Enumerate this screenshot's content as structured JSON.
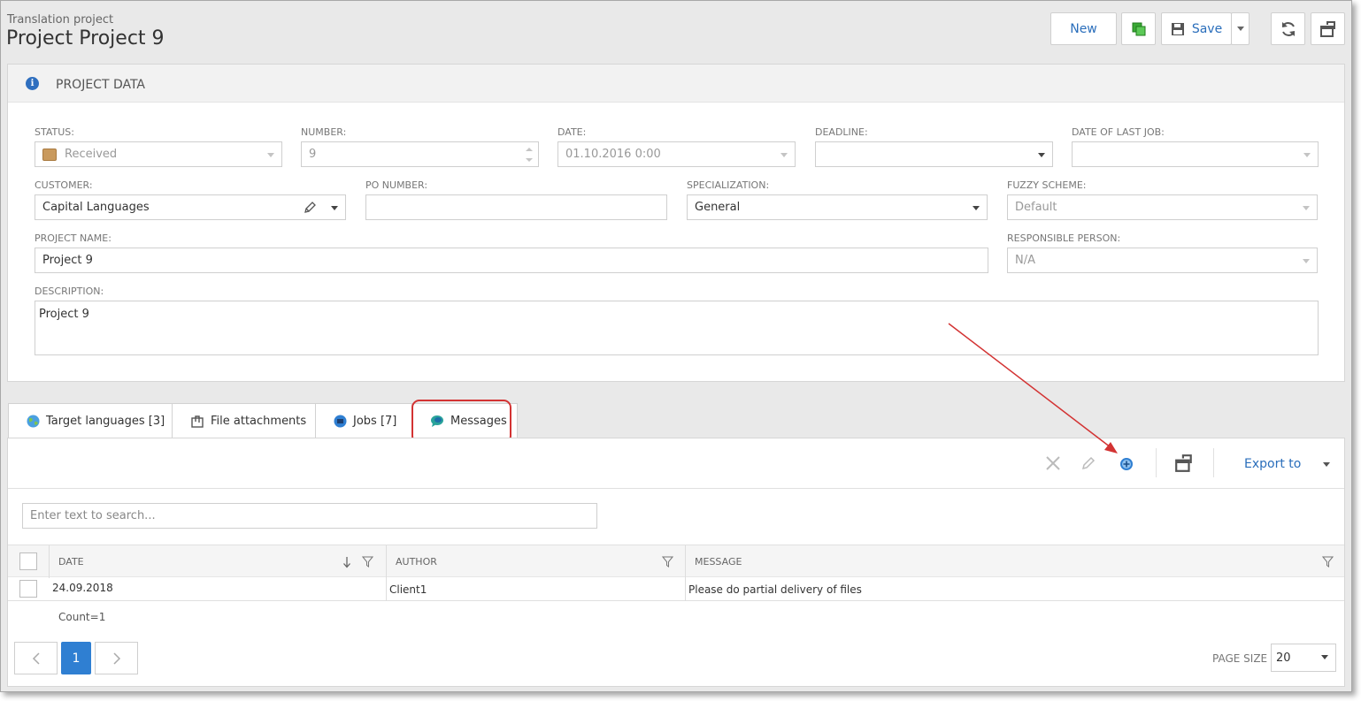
{
  "header": {
    "subtitle": "Translation project",
    "title": "Project Project 9",
    "new_label": "New",
    "save_label": "Save"
  },
  "project_data": {
    "section_title": "PROJECT DATA",
    "status": {
      "label": "STATUS:",
      "value": "Received"
    },
    "number": {
      "label": "NUMBER:",
      "value": "9"
    },
    "date": {
      "label": "DATE:",
      "value": "01.10.2016 0:00"
    },
    "deadline": {
      "label": "DEADLINE:",
      "value": ""
    },
    "date_last_job": {
      "label": "DATE OF LAST JOB:",
      "value": ""
    },
    "customer": {
      "label": "CUSTOMER:",
      "value": "Capital Languages"
    },
    "po_number": {
      "label": "PO NUMBER:",
      "value": ""
    },
    "specialization": {
      "label": "SPECIALIZATION:",
      "value": "General"
    },
    "fuzzy_scheme": {
      "label": "FUZZY SCHEME:",
      "value": "Default"
    },
    "project_name": {
      "label": "PROJECT NAME:",
      "value": "Project 9"
    },
    "responsible_person": {
      "label": "RESPONSIBLE PERSON:",
      "value": "N/A"
    },
    "description": {
      "label": "DESCRIPTION:",
      "value": "Project 9"
    }
  },
  "tabs": [
    {
      "label": "Target languages [3]"
    },
    {
      "label": "File attachments"
    },
    {
      "label": "Jobs [7]"
    },
    {
      "label": "Messages"
    }
  ],
  "messages": {
    "export_label": "Export to",
    "search_placeholder": "Enter text to search...",
    "columns": [
      "DATE",
      "AUTHOR",
      "MESSAGE"
    ],
    "rows": [
      {
        "date": "24.09.2018",
        "author": "Client1",
        "message": "Please do partial delivery of files"
      }
    ],
    "count": "Count=1",
    "page": "1",
    "page_size_label": "PAGE SIZE",
    "page_size": "20"
  },
  "colors": {
    "accent": "#2a6ebb",
    "annotation": "#d33333"
  }
}
